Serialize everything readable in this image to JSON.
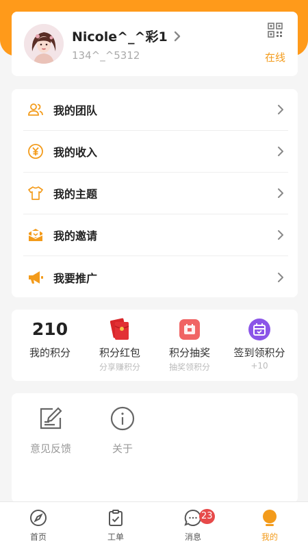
{
  "profile": {
    "username": "Nicole^_^彩1",
    "phone": "134^_^5312",
    "status": "在线"
  },
  "menu": {
    "items": [
      {
        "label": "我的团队",
        "icon": "team-icon"
      },
      {
        "label": "我的收入",
        "icon": "income-icon"
      },
      {
        "label": "我的主题",
        "icon": "theme-shirt-icon"
      },
      {
        "label": "我的邀请",
        "icon": "invite-envelope-icon"
      },
      {
        "label": "我要推广",
        "icon": "megaphone-icon"
      }
    ]
  },
  "points": {
    "my_points": {
      "value": "210",
      "label": "我的积分"
    },
    "red_packet": {
      "label": "积分红包",
      "sub": "分享赚积分",
      "icon": "red-packet-icon"
    },
    "lottery": {
      "label": "积分抽奖",
      "sub": "抽奖领积分",
      "icon": "lottery-icon"
    },
    "checkin": {
      "label": "签到领积分",
      "sub": "+10",
      "icon": "checkin-calendar-icon"
    }
  },
  "tools": [
    {
      "label": "意见反馈",
      "icon": "feedback-icon"
    },
    {
      "label": "关于",
      "icon": "info-icon"
    }
  ],
  "tabbar": {
    "tabs": [
      {
        "label": "首页",
        "icon": "compass-icon"
      },
      {
        "label": "工单",
        "icon": "clipboard-icon"
      },
      {
        "label": "消息",
        "icon": "chat-icon",
        "badge": "23"
      },
      {
        "label": "我的",
        "icon": "user-icon",
        "active": true
      }
    ]
  },
  "colors": {
    "accent": "#f39b1b",
    "header_bg": "#ff9a1a",
    "badge": "#e74a4a",
    "checkin": "#8b55e8",
    "lottery": "#f06464"
  }
}
